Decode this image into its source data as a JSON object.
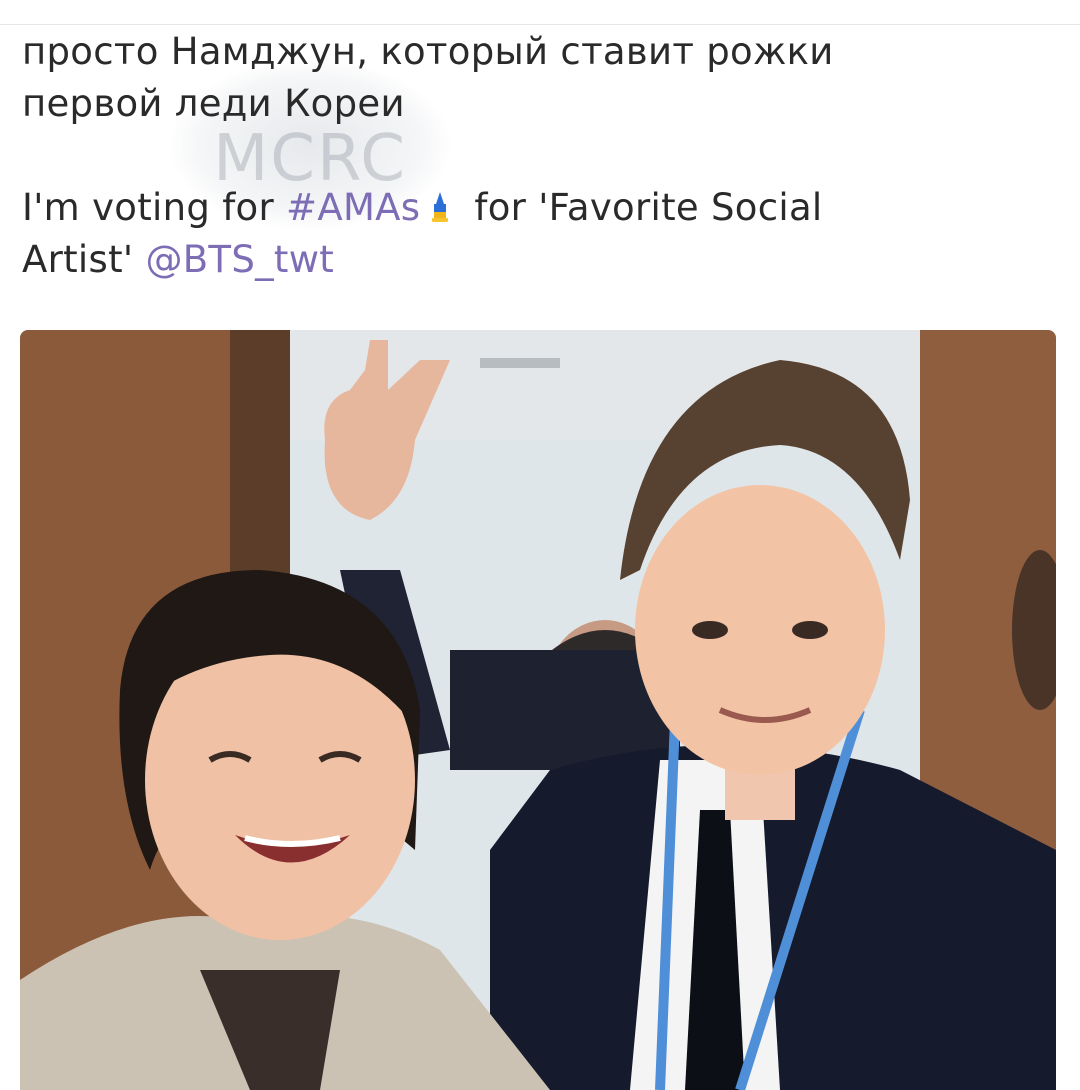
{
  "watermark": {
    "text": "MCRC"
  },
  "caption": {
    "line1": "просто Намджун, который ставит рожки",
    "line2": "первой леди Кореи"
  },
  "tweet": {
    "vote_prefix": "I'm voting for ",
    "hashtag": "#AMAs",
    "vote_icon": "ballot-pencil-icon",
    "vote_suffix": "for 'Favorite Social",
    "line2_prefix": "Artist' ",
    "mention": "@BTS_twt"
  },
  "colors": {
    "link": "#7d6db5",
    "text": "#2a2a2a"
  },
  "photo": {
    "description_icon": "photo-image"
  }
}
